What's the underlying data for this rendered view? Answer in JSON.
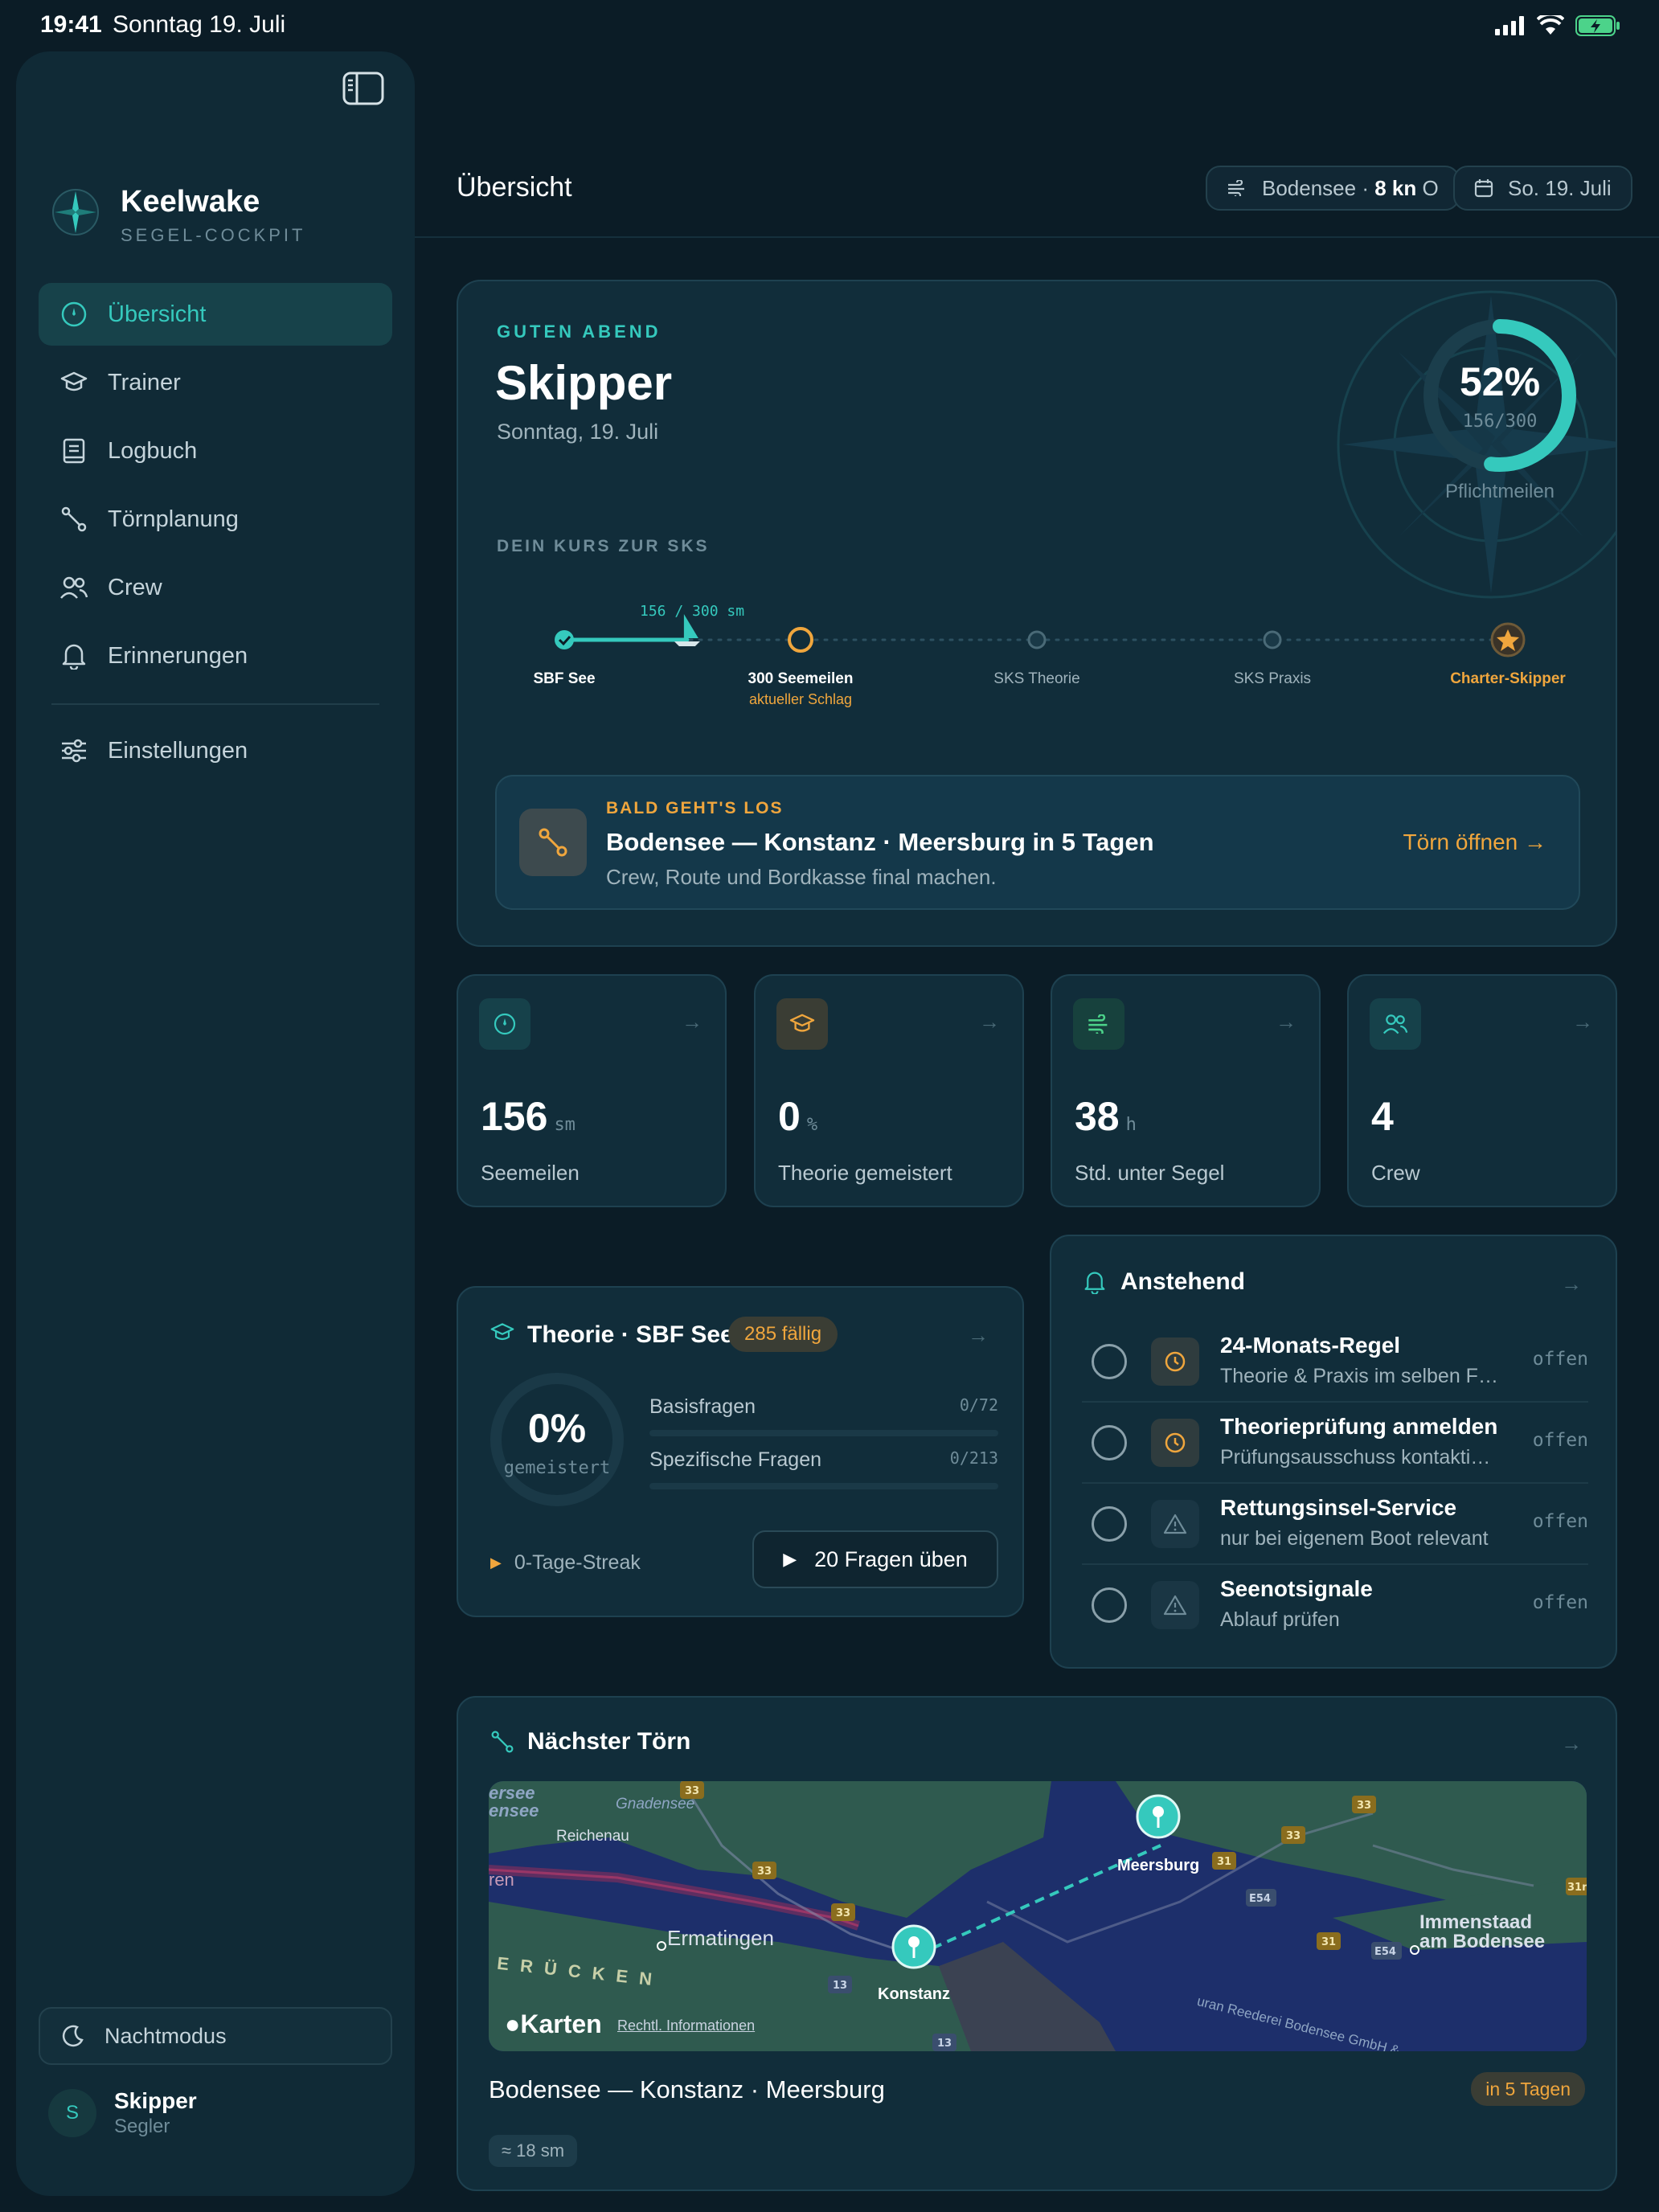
{
  "status_bar": {
    "time": "19:41",
    "date": "Sonntag 19. Juli"
  },
  "brand": {
    "name": "Keelwake",
    "subtitle": "SEGEL-COCKPIT"
  },
  "nav": {
    "items": [
      {
        "label": "Übersicht",
        "icon": "compass-icon",
        "active": true
      },
      {
        "label": "Trainer",
        "icon": "graduation-cap-icon"
      },
      {
        "label": "Logbuch",
        "icon": "book-icon"
      },
      {
        "label": "Törnplanung",
        "icon": "route-icon"
      },
      {
        "label": "Crew",
        "icon": "users-icon"
      },
      {
        "label": "Erinnerungen",
        "icon": "bell-icon"
      }
    ],
    "settings": {
      "label": "Einstellungen",
      "icon": "sliders-icon"
    }
  },
  "night_mode": {
    "label": "Nachtmodus"
  },
  "user": {
    "initial": "S",
    "name": "Skipper",
    "role": "Segler"
  },
  "header": {
    "title": "Übersicht",
    "weather": {
      "location": "Bodensee · ",
      "wind": "8 kn",
      "direction": " O"
    },
    "date": "So. 19. Juli"
  },
  "hero": {
    "greeting": "GUTEN ABEND",
    "name": "Skipper",
    "date": "Sonntag, 19. Juli",
    "progress": {
      "percent_label": "52%",
      "value": 156,
      "max": 300,
      "fraction_label": "156/300",
      "label": "Pflichtmeilen"
    },
    "course_title": "DEIN KURS ZUR SKS",
    "track_label": "156 / 300 sm",
    "track_progress": 0.52,
    "stops": [
      {
        "label": "SBF See",
        "state": "done"
      },
      {
        "label": "300 Seemeilen",
        "sub": "aktueller Schlag",
        "state": "current"
      },
      {
        "label": "SKS Theorie",
        "state": "open"
      },
      {
        "label": "SKS Praxis",
        "state": "open"
      },
      {
        "label": "Charter-Skipper",
        "state": "goal"
      }
    ],
    "banner": {
      "kicker": "BALD GEHT'S LOS",
      "title": "Bodensee — Konstanz · Meersburg in 5 Tagen",
      "subtitle": "Crew, Route und Bordkasse final machen.",
      "cta": "Törn öffnen →"
    }
  },
  "stats": [
    {
      "value": "156",
      "unit": "sm",
      "label": "Seemeilen",
      "icon": "compass-icon",
      "color": "#35c9bd",
      "bg": "#16414a"
    },
    {
      "value": "0",
      "unit": "%",
      "label": "Theorie gemeistert",
      "icon": "graduation-cap-icon",
      "color": "#f0a63d",
      "bg": "#3a3d34"
    },
    {
      "value": "38",
      "unit": "h",
      "label": "Std. unter Segel",
      "icon": "wind-icon",
      "color": "#4cd38a",
      "bg": "#17413d"
    },
    {
      "value": "4",
      "unit": "",
      "label": "Crew",
      "icon": "users-icon",
      "color": "#35c9bd",
      "bg": "#16414a"
    }
  ],
  "theory": {
    "title": "Theorie · SBF See",
    "badge": "285 fällig",
    "percent_label": "0%",
    "percent_sub": "gemeistert",
    "bars": [
      {
        "label": "Basisfragen",
        "count": "0/72",
        "progress": 0
      },
      {
        "label": "Spezifische Fragen",
        "count": "0/213",
        "progress": 0
      }
    ],
    "streak": "0-Tage-Streak",
    "practice_button": "20 Fragen üben"
  },
  "upcoming": {
    "title": "Anstehend",
    "items": [
      {
        "name": "24-Monats-Regel",
        "desc": "Theorie & Praxis im selben Fenster",
        "status": "offen",
        "icon": "clock-icon"
      },
      {
        "name": "Theorieprüfung anmelden",
        "desc": "Prüfungsausschuss kontaktieren",
        "status": "offen",
        "icon": "clock-icon"
      },
      {
        "name": "Rettungsinsel-Service",
        "desc": "nur bei eigenem Boot relevant",
        "status": "offen",
        "icon": "warning-icon"
      },
      {
        "name": "Seenotsignale",
        "desc": "Ablauf prüfen",
        "status": "offen",
        "icon": "warning-icon"
      }
    ]
  },
  "next_trip": {
    "title": "Nächster Törn",
    "map": {
      "labels": {
        "untersee_a": "ersee",
        "untersee_b": "ensee",
        "reichenau": "Reichenau",
        "gnadensee": "Gnadensee",
        "rhein": "ren",
        "ermatingen": "Ermatingen",
        "ruecken": "E R Ü C K E N",
        "konstanz": "Konstanz",
        "meersburg": "Meersburg",
        "immenstaad_a": "Immenstaad",
        "immenstaad_b": "am Bodensee",
        "reederei": "uran Reederei Bodensee GmbH &"
      },
      "road_badges": [
        "33",
        "33",
        "33",
        "33",
        "33",
        "31",
        "31",
        "31n",
        "E54",
        "E54",
        "13",
        "13"
      ],
      "brand": "Karten",
      "legal": "Rechtl. Informationen"
    },
    "route": "Bodensee — Konstanz · Meersburg",
    "badge": "in 5 Tagen",
    "distance": "≈ 18 sm"
  }
}
